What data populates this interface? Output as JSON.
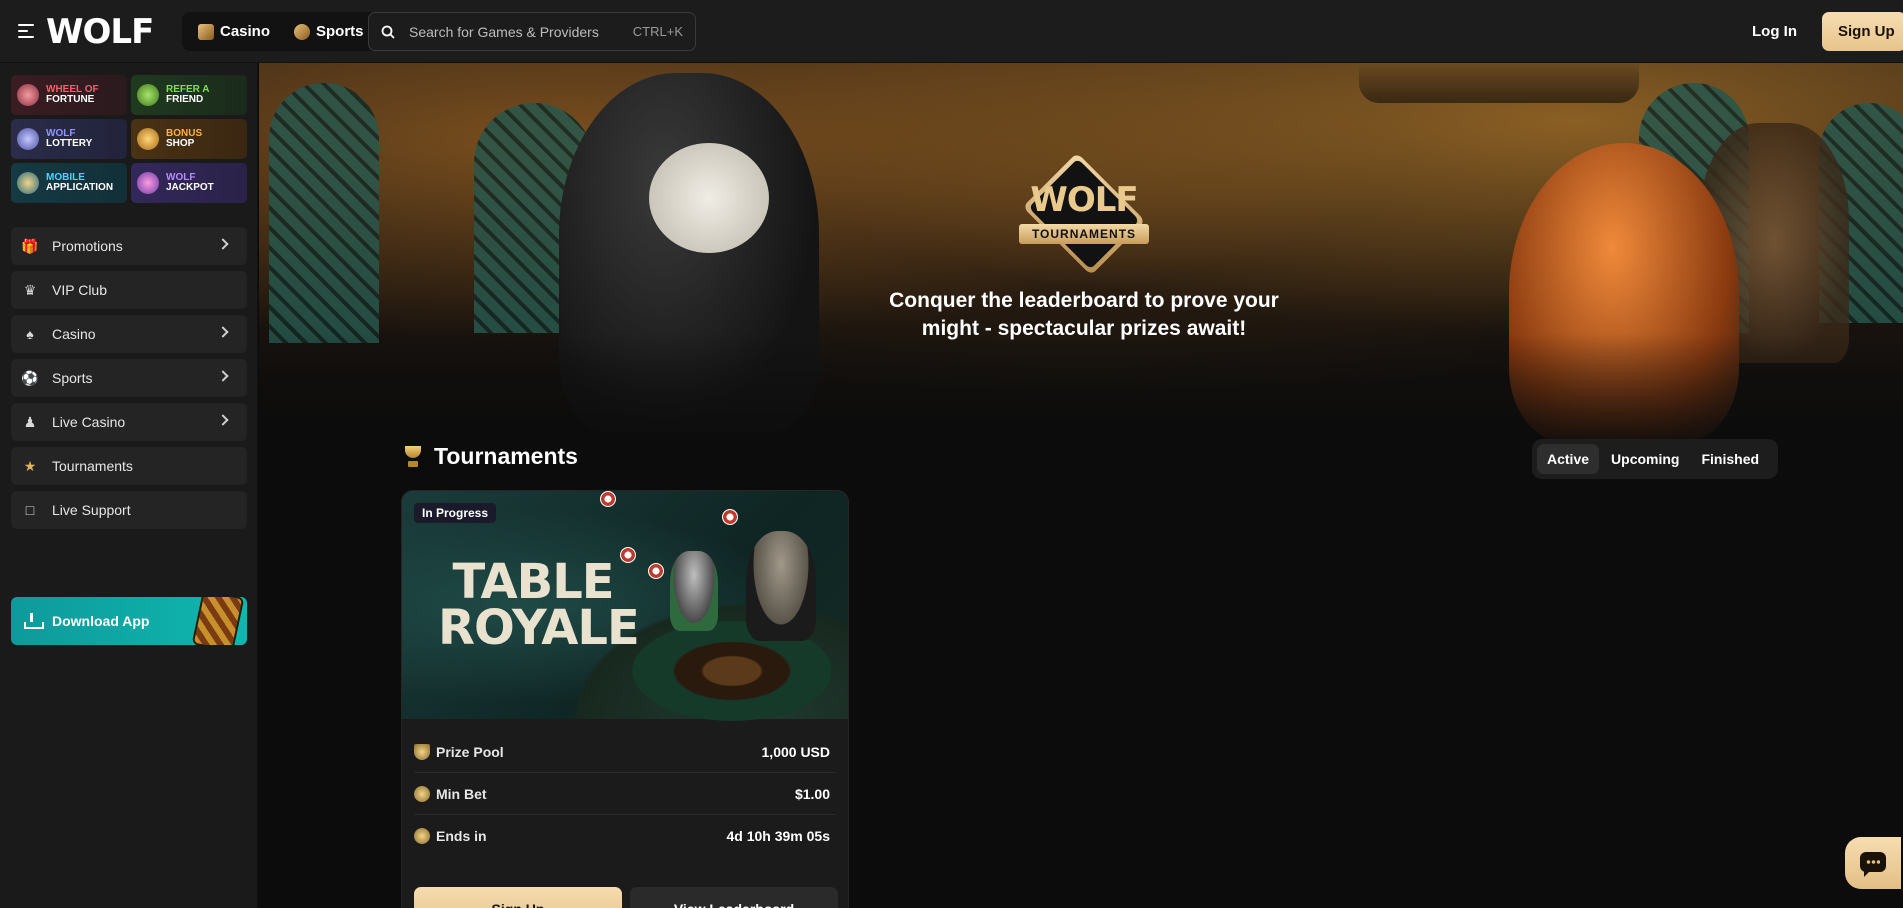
{
  "header": {
    "logo": "WOLF",
    "modes": [
      {
        "label": "Casino",
        "icon": "casino-icon"
      },
      {
        "label": "Sports",
        "icon": "sports-ball-icon"
      }
    ],
    "search": {
      "placeholder": "Search for Games & Providers",
      "shortcut": "CTRL+K"
    },
    "login_label": "Log In",
    "signup_label": "Sign Up"
  },
  "sidebar": {
    "promo_tiles": [
      {
        "line1": "Wheel of",
        "line2": "Fortune",
        "accent": "#ff5a6e",
        "icon": "wheel-icon"
      },
      {
        "line1": "Refer a",
        "line2": "Friend",
        "accent": "#7de04e",
        "icon": "megaphone-icon"
      },
      {
        "line1": "Wolf",
        "line2": "Lottery",
        "accent": "#8e95ff",
        "icon": "lottery-icon"
      },
      {
        "line1": "Bonus",
        "line2": "Shop",
        "accent": "#ffb23a",
        "icon": "shop-icon"
      },
      {
        "line1": "Mobile",
        "line2": "Application",
        "accent": "#49d4ff",
        "icon": "mobile-icon"
      },
      {
        "line1": "Wolf",
        "line2": "Jackpot",
        "accent": "#b58cff",
        "icon": "jackpot-icon"
      }
    ],
    "nav": [
      {
        "label": "Promotions",
        "icon": "gift-icon",
        "expandable": true
      },
      {
        "label": "VIP Club",
        "icon": "crown-icon",
        "expandable": false
      },
      {
        "label": "Casino",
        "icon": "casino-icon",
        "expandable": true
      },
      {
        "label": "Sports",
        "icon": "ball-icon",
        "expandable": true
      },
      {
        "label": "Live Casino",
        "icon": "dealer-icon",
        "expandable": true
      },
      {
        "label": "Tournaments",
        "icon": "trophy-icon",
        "expandable": false
      },
      {
        "label": "Live Support",
        "icon": "chat-icon",
        "expandable": false
      }
    ],
    "download_label": "Download App"
  },
  "hero": {
    "logo_word": "WOLF",
    "logo_band": "TOURNAMENTS",
    "tagline_line1": "Conquer the leaderboard to prove your",
    "tagline_line2": "might - spectacular prizes await!"
  },
  "tournaments": {
    "title": "Tournaments",
    "tabs": [
      {
        "label": "Active",
        "active": true
      },
      {
        "label": "Upcoming",
        "active": false
      },
      {
        "label": "Finished",
        "active": false
      }
    ],
    "card": {
      "status": "In Progress",
      "name_line1": "TABLE",
      "name_line2": "ROYALE",
      "rows": [
        {
          "label": "Prize Pool",
          "value": "1,000 USD",
          "icon": "trophy-icon"
        },
        {
          "label": "Min Bet",
          "value": "$1.00",
          "icon": "coin-icon"
        },
        {
          "label": "Ends in",
          "value": "4d 10h 39m 05s",
          "icon": "timer-icon"
        }
      ],
      "signup_label": "Sign Up",
      "leaderboard_label": "View Leaderboard"
    }
  },
  "colors": {
    "accent_gold": "#e8c48c",
    "download_teal": "#0fb7b0"
  }
}
